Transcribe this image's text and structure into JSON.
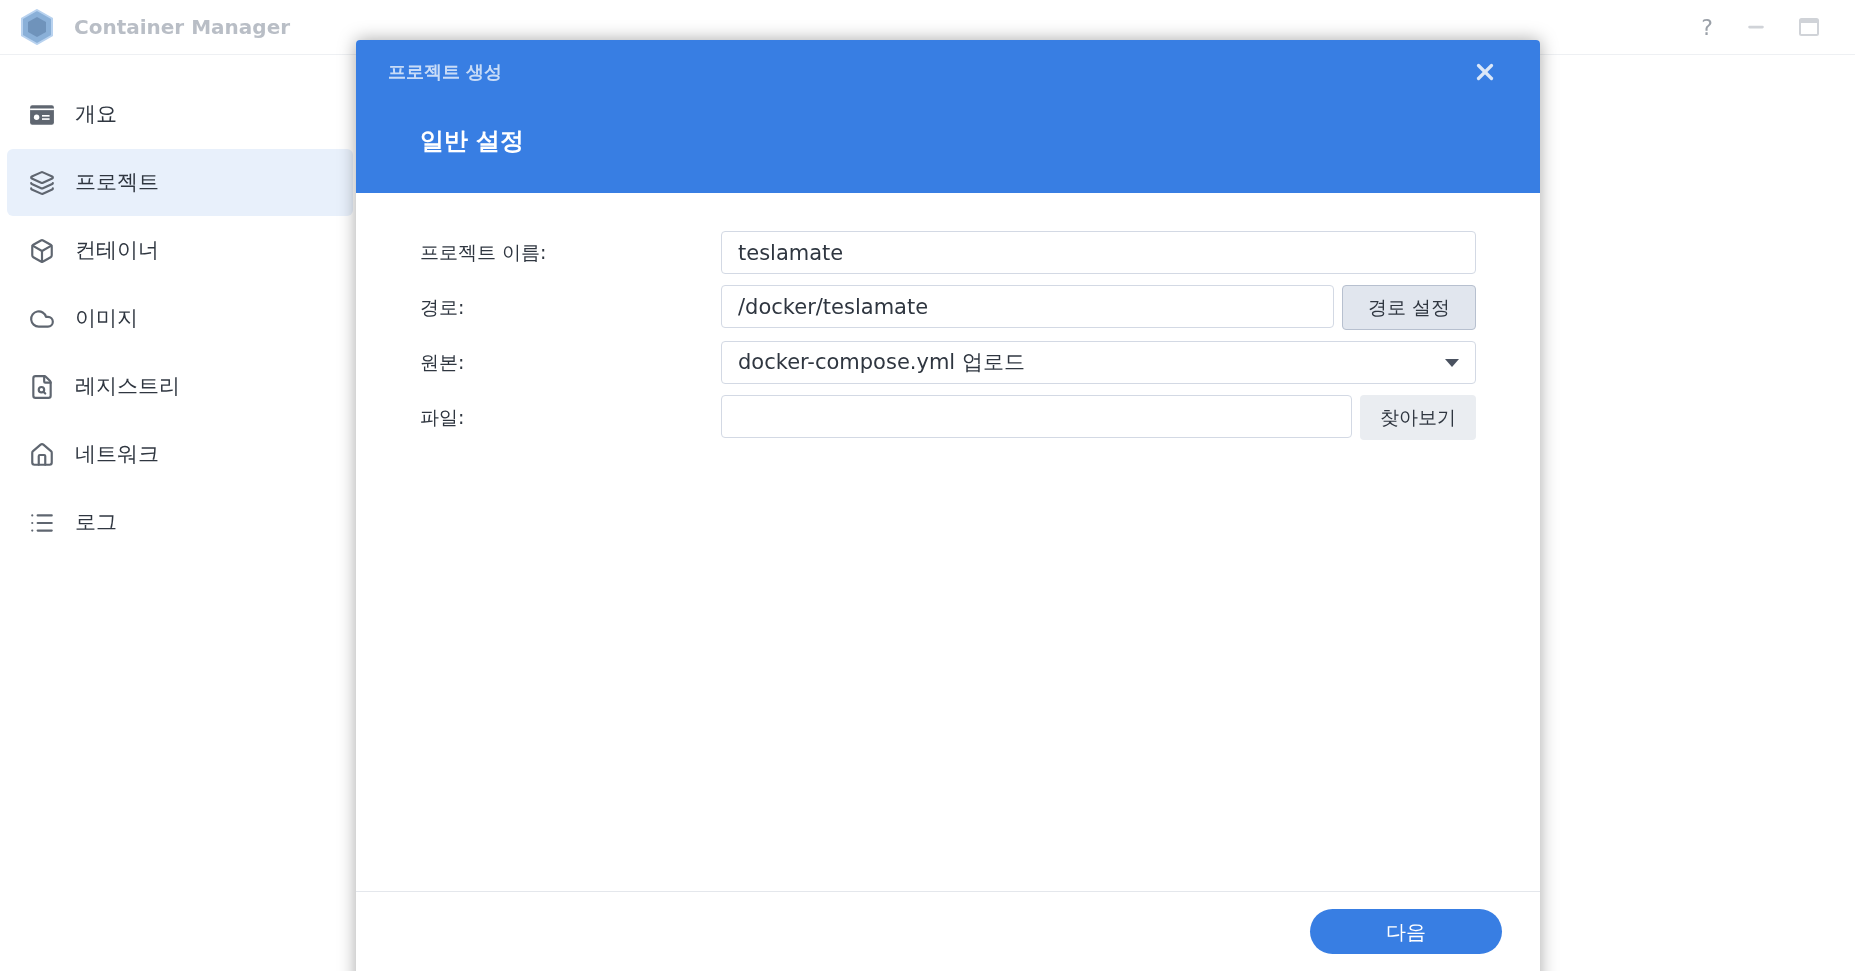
{
  "app": {
    "title": "Container Manager",
    "window_buttons": [
      "?"
    ]
  },
  "sidebar": {
    "items": [
      {
        "label": "개요",
        "selected": false
      },
      {
        "label": "프로젝트",
        "selected": true
      },
      {
        "label": "컨테이너",
        "selected": false
      },
      {
        "label": "이미지",
        "selected": false
      },
      {
        "label": "레지스트리",
        "selected": false
      },
      {
        "label": "네트워크",
        "selected": false
      },
      {
        "label": "로그",
        "selected": false
      }
    ]
  },
  "dialog": {
    "title": "프로젝트 생성",
    "step": "일반 설정",
    "fields": [
      {
        "kind": "text",
        "label": "프로젝트 이름:",
        "value": "teslamate"
      },
      {
        "kind": "text_button",
        "label": "경로:",
        "value": "/docker/teslamate",
        "button": "경로 설정"
      },
      {
        "kind": "select",
        "label": "원본:",
        "value": "docker-compose.yml 업로드"
      },
      {
        "kind": "file",
        "label": "파일:",
        "button": "찾아보기"
      }
    ],
    "next_button": "다음"
  }
}
